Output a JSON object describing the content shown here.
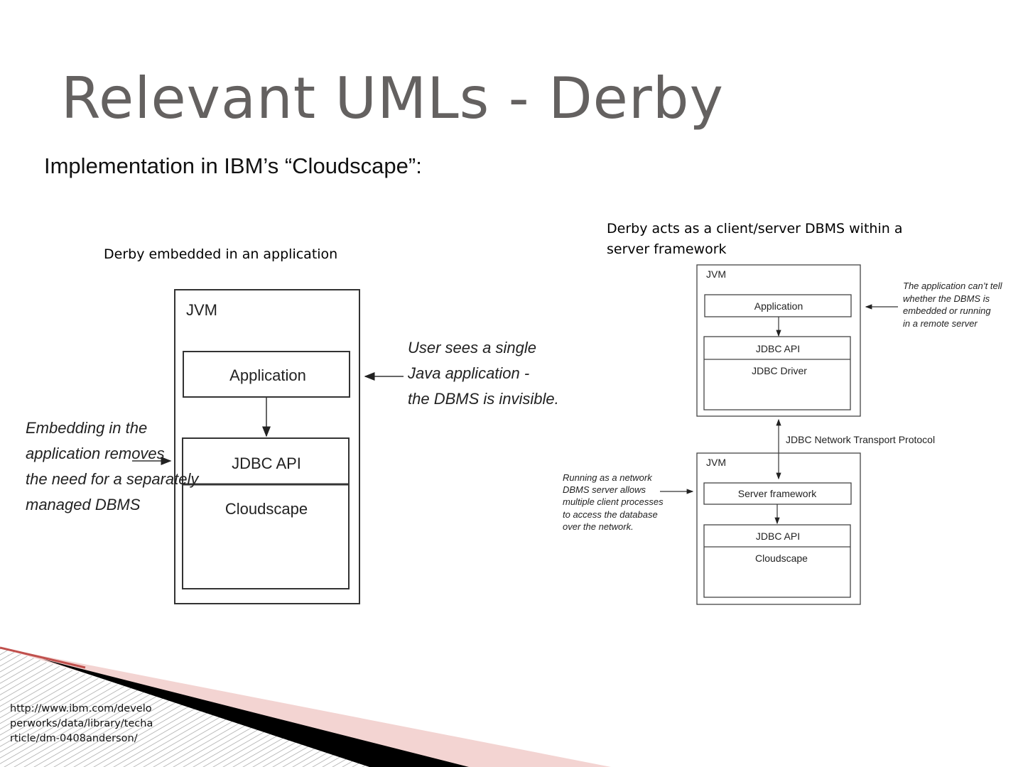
{
  "slide": {
    "title": "Relevant UMLs - Derby",
    "subtitle": "Implementation in IBM’s “Cloudscape”:",
    "citation": [
      "http://www.ibm.com/develo",
      "perworks/data/library/techa",
      "rticle/dm-0408anderson/"
    ]
  },
  "left_diagram": {
    "caption": "Derby embedded in an application",
    "jvm_label": "JVM",
    "application_label": "Application",
    "jdbc_api_label": "JDBC API",
    "cloudscape_label": "Cloudscape",
    "right_note": [
      "User sees a single",
      "Java application -",
      "the DBMS is invisible."
    ],
    "left_note": [
      "Embedding in the",
      "application removes",
      "the need for a separately",
      "managed DBMS"
    ]
  },
  "right_diagram": {
    "caption_lines": [
      "Derby acts as a client/server DBMS within a",
      "server framework"
    ],
    "top_jvm_label": "JVM",
    "application_label": "Application",
    "jdbc_api_label": "JDBC API",
    "jdbc_driver_label": "JDBC Driver",
    "protocol_label": "JDBC Network Transport Protocol",
    "bottom_jvm_label": "JVM",
    "server_framework_label": "Server framework",
    "bottom_jdbc_api_label": "JDBC API",
    "cloudscape_label": "Cloudscape",
    "top_note": [
      "The application can’t tell",
      "whether the DBMS is",
      "embedded or running",
      "in a remote server"
    ],
    "bottom_note": [
      "Running as a network",
      "DBMS server allows",
      "multiple client processes",
      "to access the database",
      "over the network."
    ]
  },
  "colors": {
    "title": "#646160",
    "accent_red": "#c0504d",
    "accent_pink": "#f3d4d2"
  }
}
